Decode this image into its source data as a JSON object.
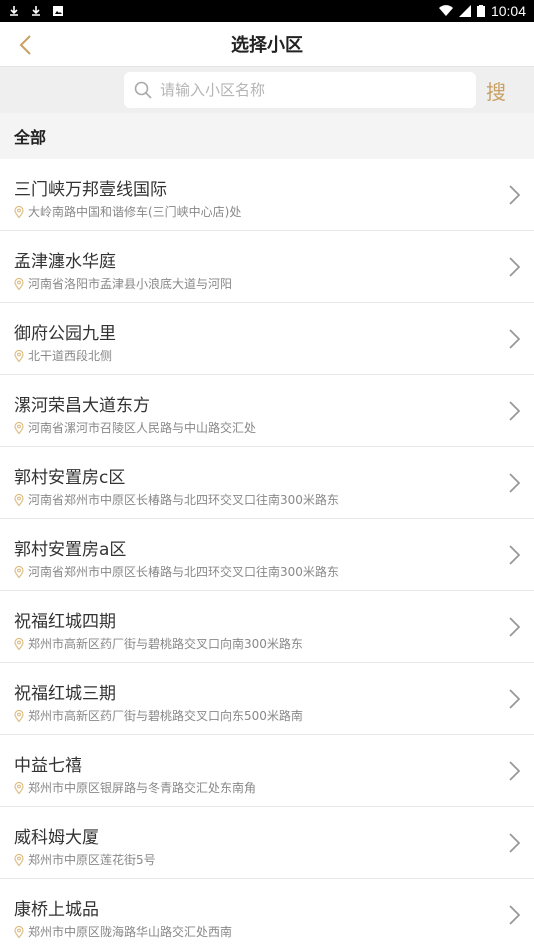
{
  "status_bar": {
    "time": "10:04"
  },
  "nav": {
    "title": "选择小区"
  },
  "search": {
    "placeholder": "请输入小区名称",
    "button_label": "搜"
  },
  "section": {
    "title": "全部"
  },
  "communities": [
    {
      "name": "三门峡万邦壹线国际",
      "address": "大岭南路中国和谐修车(三门峡中心店)处"
    },
    {
      "name": "孟津瀍水华庭",
      "address": "河南省洛阳市孟津县小浪底大道与河阳"
    },
    {
      "name": "御府公园九里",
      "address": "北干道西段北侧"
    },
    {
      "name": "漯河荣昌大道东方",
      "address": "河南省漯河市召陵区人民路与中山路交汇处"
    },
    {
      "name": "郭村安置房c区",
      "address": "河南省郑州市中原区长椿路与北四环交叉口往南300米路东"
    },
    {
      "name": "郭村安置房a区",
      "address": "河南省郑州市中原区长椿路与北四环交叉口往南300米路东"
    },
    {
      "name": "祝福红城四期",
      "address": "郑州市高新区药厂街与碧桃路交叉口向南300米路东"
    },
    {
      "name": "祝福红城三期",
      "address": "郑州市高新区药厂街与碧桃路交叉口向东500米路南"
    },
    {
      "name": "中益七禧",
      "address": "郑州市中原区银屏路与冬青路交汇处东南角"
    },
    {
      "name": "威科姆大厦",
      "address": "郑州市中原区莲花街5号"
    },
    {
      "name": "康桥上城品",
      "address": "郑州市中原区陇海路华山路交汇处西南"
    }
  ],
  "colors": {
    "accent": "#c9a063",
    "location_icon": "#e0b97a"
  }
}
